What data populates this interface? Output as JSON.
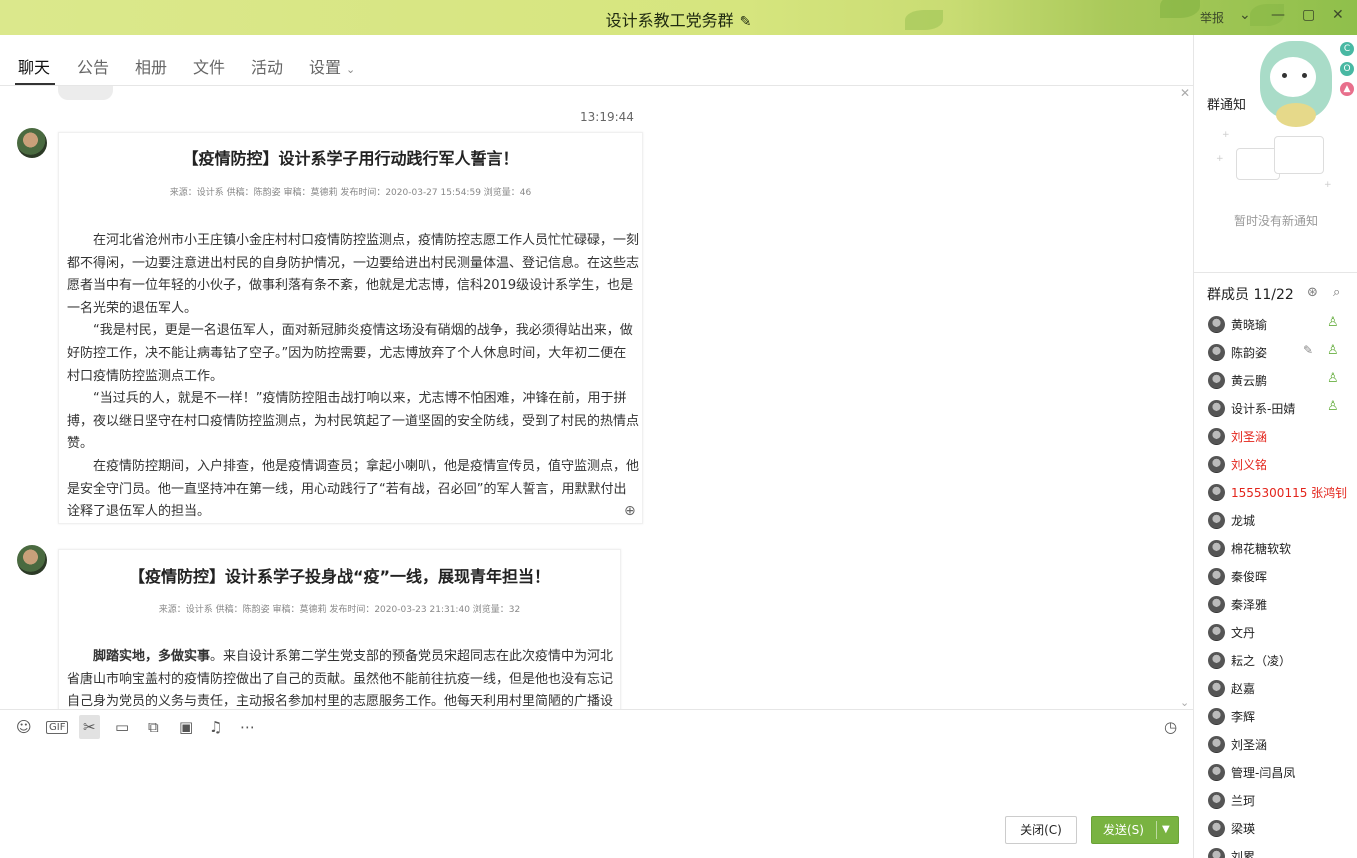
{
  "window": {
    "title": "设计系教工党务群",
    "report_label": "举报"
  },
  "tabs": [
    {
      "label": "聊天"
    },
    {
      "label": "公告"
    },
    {
      "label": "相册"
    },
    {
      "label": "文件"
    },
    {
      "label": "活动"
    },
    {
      "label": "设置"
    }
  ],
  "chat": {
    "timestamp": "13:19:44",
    "messages": [
      {
        "title": "【疫情防控】设计系学子用行动践行军人誓言！",
        "meta": "来源：设计系   供稿：陈韵姿   审稿：莫德莉   发布时间：2020-03-27 15:54:59   浏览量：46",
        "paragraphs": [
          "在河北省沧州市小王庄镇小金庄村村口疫情防控监测点，疫情防控志愿工作人员忙忙碌碌，一刻都不得闲，一边要注意进出村民的自身防护情况，一边要给进出村民测量体温、登记信息。在这些志愿者当中有一位年轻的小伙子，做事利落有条不紊，他就是尤志博，信科2019级设计系学生，也是一名光荣的退伍军人。",
          "“我是村民，更是一名退伍军人，面对新冠肺炎疫情这场没有硝烟的战争，我必须得站出来，做好防控工作，决不能让病毒钻了空子。”因为防控需要，尤志博放弃了个人休息时间，大年初二便在村口疫情防控监测点工作。",
          "“当过兵的人，就是不一样！”疫情防控阻击战打响以来，尤志博不怕困难，冲锋在前，用于拼搏，夜以继日坚守在村口疫情防控监测点，为村民筑起了一道坚固的安全防线，受到了村民的热情点赞。",
          "在疫情防控期间，入户排查，他是疫情调查员；拿起小喇叭，他是疫情宣传员，值守监测点，他是安全守门员。他一直坚持冲在第一线，用心动践行了“若有战，召必回”的军人誓言，用默默付出诠释了退伍军人的担当。"
        ]
      },
      {
        "title": "【疫情防控】设计系学子投身战“疫”一线，展现青年担当！",
        "meta": "来源：设计系   供稿：陈韵姿   审稿：莫德莉   发布时间：2020-03-23 21:31:40   浏览量：32",
        "lead": "脚踏实地，多做实事",
        "body": "。来自设计系第二学生党支部的预备党员宋超同志在此次疫情中为河北省唐山市响宝盖村的疫情防控做出了自己的贡献。虽然他不能前往抗疫一线，但是他也没有忘记自己身为党员的义务与责任，主动报名参加村里的志愿服务工作。他每天利用村里简陋的广播设备为村民讲解"
      }
    ]
  },
  "composer": {
    "close_label": "关闭(C)",
    "send_label": "发送(S)"
  },
  "notice": {
    "title": "群通知",
    "empty": "暂时没有新通知"
  },
  "members": {
    "title": "群成员 11/22",
    "list": [
      {
        "name": "黄晓瑜",
        "red": false,
        "badge": true
      },
      {
        "name": "陈韵姿",
        "red": false,
        "badge": true,
        "edit": true
      },
      {
        "name": "黄云鹏",
        "red": false,
        "badge": true
      },
      {
        "name": "设计系-田婧",
        "red": false,
        "badge": true
      },
      {
        "name": "刘圣涵",
        "red": true
      },
      {
        "name": "刘义铭",
        "red": true
      },
      {
        "name": "1555300115  张鸿钊",
        "red": true
      },
      {
        "name": "龙城",
        "red": false
      },
      {
        "name": "棉花糖软软",
        "red": false
      },
      {
        "name": "秦俊晖",
        "red": false
      },
      {
        "name": "秦泽雅",
        "red": false
      },
      {
        "name": "文丹",
        "red": false
      },
      {
        "name": "耘之（凌）",
        "red": false
      },
      {
        "name": "赵嘉",
        "red": false
      },
      {
        "name": "李辉",
        "red": false
      },
      {
        "name": "刘圣涵",
        "red": false
      },
      {
        "name": "管理-闫昌凤",
        "red": false
      },
      {
        "name": "兰珂",
        "red": false
      },
      {
        "name": "梁瑛",
        "red": false
      },
      {
        "name": "刘累",
        "red": false
      }
    ]
  },
  "icons": {
    "edit": "pencil-icon",
    "phone": "phone-icon",
    "zoom": "zoom-in-icon",
    "emoji": "emoji-icon",
    "gif": "gif-icon",
    "scissors": "scissors-icon",
    "folder": "folder-icon",
    "image": "image-icon",
    "bell": "bell-icon",
    "more": "more-icon",
    "history": "clock-icon"
  },
  "colors": {
    "titlebar": "#d6e57e",
    "accent": "#79b341",
    "alert": "#e3241b"
  }
}
